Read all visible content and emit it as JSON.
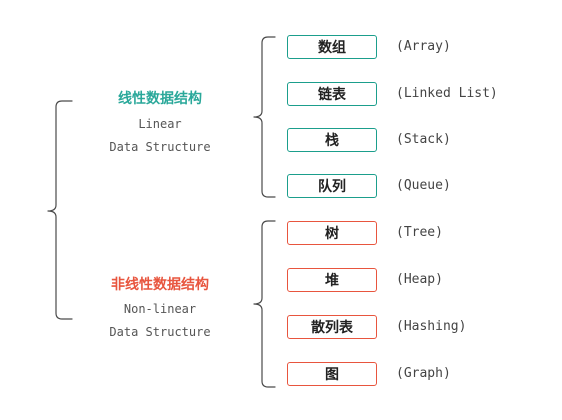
{
  "colors": {
    "linear_accent": "#2aa89a",
    "linear_border": "#1b9e8c",
    "nonlinear_accent": "#e8553e",
    "bracket": "#4a4a4a"
  },
  "linear": {
    "title_zh": "线性数据结构",
    "title_en_line1": "Linear",
    "title_en_line2": "Data Structure",
    "items": [
      {
        "zh": "数组",
        "en": "(Array)"
      },
      {
        "zh": "链表",
        "en": "(Linked List)"
      },
      {
        "zh": "栈",
        "en": "(Stack)"
      },
      {
        "zh": "队列",
        "en": "(Queue)"
      }
    ]
  },
  "nonlinear": {
    "title_zh": "非线性数据结构",
    "title_en_line1": "Non-linear",
    "title_en_line2": "Data Structure",
    "items": [
      {
        "zh": "树",
        "en": "(Tree)"
      },
      {
        "zh": "堆",
        "en": "(Heap)"
      },
      {
        "zh": "散列表",
        "en": "(Hashing)"
      },
      {
        "zh": "图",
        "en": "(Graph)"
      }
    ]
  }
}
